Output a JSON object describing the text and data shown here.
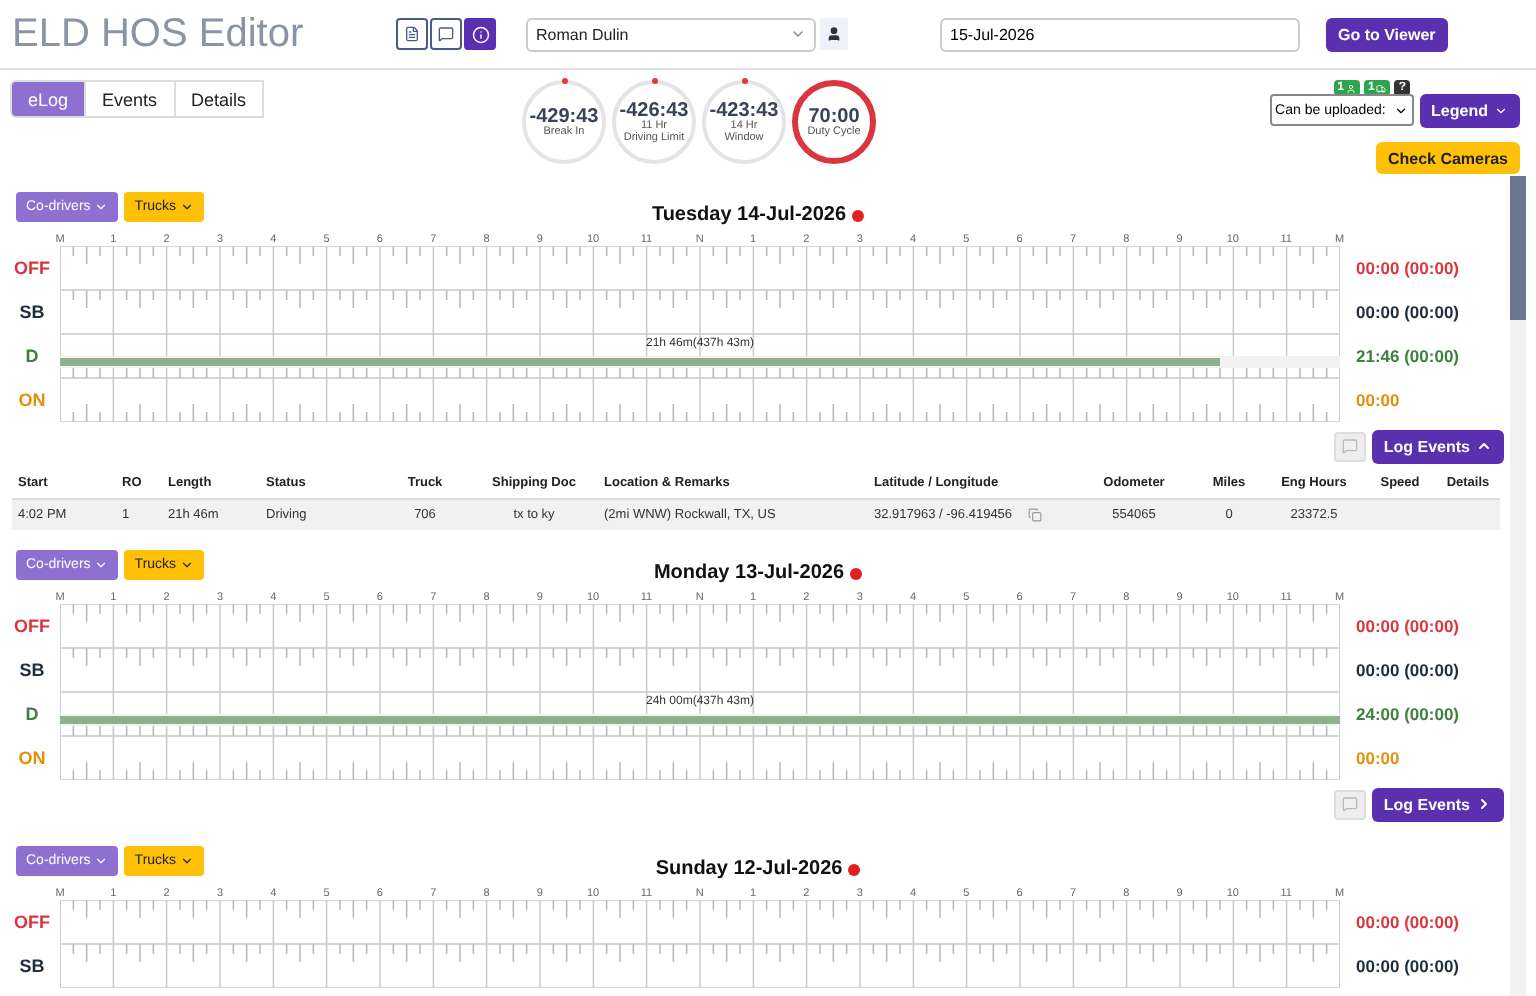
{
  "header": {
    "title": "ELD HOS Editor",
    "driver": "Roman Dulin",
    "date": "15-Jul-2026",
    "go_button": "Go to Viewer"
  },
  "tabs": [
    {
      "label": "eLog",
      "selected": true
    },
    {
      "label": "Events",
      "selected": false
    },
    {
      "label": "Details",
      "selected": false
    }
  ],
  "gauges": [
    {
      "value": "-429:43",
      "label": "Break In",
      "alert": false
    },
    {
      "value": "-426:43",
      "label": "11 Hr\nDriving Limit",
      "alert": false
    },
    {
      "value": "-423:43",
      "label": "14 Hr\nWindow",
      "alert": false
    },
    {
      "value": "70:00",
      "label": "Duty Cycle",
      "alert": true
    }
  ],
  "badges": [
    {
      "kind": "user",
      "text": "1"
    },
    {
      "kind": "truck",
      "text": "1"
    },
    {
      "kind": "help",
      "text": "?"
    }
  ],
  "upload_select": "Can be uploaded:",
  "legend_button": "Legend",
  "cameras_button": "Check Cameras",
  "days": [
    {
      "title": "Tuesday 14-Jul-2026",
      "co_drivers": "Co-drivers",
      "trucks": "Trucks",
      "hours": [
        "M",
        "1",
        "2",
        "3",
        "4",
        "5",
        "6",
        "7",
        "8",
        "9",
        "10",
        "11",
        "N",
        "1",
        "2",
        "3",
        "4",
        "5",
        "6",
        "7",
        "8",
        "9",
        "10",
        "11",
        "M"
      ],
      "rows": [
        {
          "kind": "off",
          "label": "OFF",
          "total": "00:00 (00:00)"
        },
        {
          "kind": "sb",
          "label": "SB",
          "total": "00:00 (00:00)"
        },
        {
          "kind": "d",
          "label": "D",
          "total": "21:46 (00:00)"
        },
        {
          "kind": "on",
          "label": "ON",
          "total": "00:00"
        }
      ],
      "drive_bar": {
        "level": 0.907,
        "label": "21h 46m(437h 43m)"
      },
      "log_events": {
        "label": "Log Events",
        "expanded": true
      },
      "table": {
        "columns": [
          "Start",
          "RO",
          "Length",
          "Status",
          "Truck",
          "Shipping Doc",
          "Location & Remarks",
          "Latitude / Longitude",
          "Odometer",
          "Miles",
          "Eng Hours",
          "Speed",
          "Details"
        ],
        "rows": [
          [
            "4:02 PM",
            "1",
            "21h 46m",
            "Driving",
            "706",
            "tx to ky",
            "(2mi WNW) Rockwall, TX, US",
            "32.917963 / -96.419456",
            "554065",
            "0",
            "23372.5",
            "",
            ""
          ]
        ]
      }
    },
    {
      "title": "Monday 13-Jul-2026",
      "co_drivers": "Co-drivers",
      "trucks": "Trucks",
      "hours": [
        "M",
        "1",
        "2",
        "3",
        "4",
        "5",
        "6",
        "7",
        "8",
        "9",
        "10",
        "11",
        "N",
        "1",
        "2",
        "3",
        "4",
        "5",
        "6",
        "7",
        "8",
        "9",
        "10",
        "11",
        "M"
      ],
      "rows": [
        {
          "kind": "off",
          "label": "OFF",
          "total": "00:00 (00:00)"
        },
        {
          "kind": "sb",
          "label": "SB",
          "total": "00:00 (00:00)"
        },
        {
          "kind": "d",
          "label": "D",
          "total": "24:00 (00:00)"
        },
        {
          "kind": "on",
          "label": "ON",
          "total": "00:00"
        }
      ],
      "drive_bar": {
        "level": 1,
        "label": "24h 00m(437h 43m)"
      },
      "log_events": {
        "label": "Log Events",
        "expanded": false
      }
    },
    {
      "title": "Sunday 12-Jul-2026",
      "co_drivers": "Co-drivers",
      "trucks": "Trucks",
      "hours": [
        "M",
        "1",
        "2",
        "3",
        "4",
        "5",
        "6",
        "7",
        "8",
        "9",
        "10",
        "11",
        "N",
        "1",
        "2",
        "3",
        "4",
        "5",
        "6",
        "7",
        "8",
        "9",
        "10",
        "11",
        "M"
      ],
      "rows": [
        {
          "kind": "off",
          "label": "OFF",
          "total": "00:00 (00:00)"
        },
        {
          "kind": "sb",
          "label": "SB",
          "total": "00:00 (00:00)"
        }
      ]
    }
  ]
}
